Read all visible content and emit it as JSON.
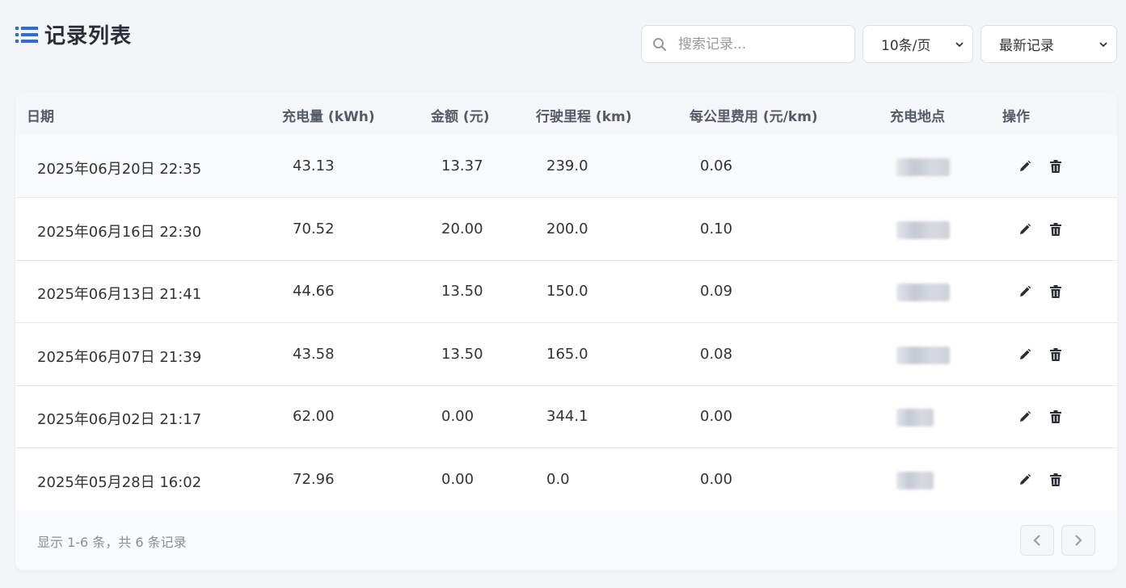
{
  "header": {
    "title": "记录列表",
    "icon": "list-icon",
    "accent_color": "#2f6be0"
  },
  "search": {
    "placeholder": "搜索记录...",
    "value": "",
    "icon": "search-icon"
  },
  "per_page": {
    "selected": "10条/页"
  },
  "sort": {
    "selected": "最新记录"
  },
  "table": {
    "columns": [
      "日期",
      "充电量 (kWh)",
      "金额 (元)",
      "行驶里程 (km)",
      "每公里费用 (元/km)",
      "充电地点",
      "操作"
    ],
    "rows": [
      {
        "date": "2025年06月20日 22:35",
        "energy": "43.13",
        "amount": "13.37",
        "distance": "239.0",
        "cost_per_km": "0.06"
      },
      {
        "date": "2025年06月16日 22:30",
        "energy": "70.52",
        "amount": "20.00",
        "distance": "200.0",
        "cost_per_km": "0.10"
      },
      {
        "date": "2025年06月13日 21:41",
        "energy": "44.66",
        "amount": "13.50",
        "distance": "150.0",
        "cost_per_km": "0.09"
      },
      {
        "date": "2025年06月07日 21:39",
        "energy": "43.58",
        "amount": "13.50",
        "distance": "165.0",
        "cost_per_km": "0.08"
      },
      {
        "date": "2025年06月02日 21:17",
        "energy": "62.00",
        "amount": "0.00",
        "distance": "344.1",
        "cost_per_km": "0.00"
      },
      {
        "date": "2025年05月28日 16:02",
        "energy": "72.96",
        "amount": "0.00",
        "distance": "0.0",
        "cost_per_km": "0.00"
      }
    ],
    "row_actions": [
      "pencil-icon",
      "trash-icon"
    ]
  },
  "footer": {
    "summary": "显示 1-6 条，共 6 条记录"
  }
}
